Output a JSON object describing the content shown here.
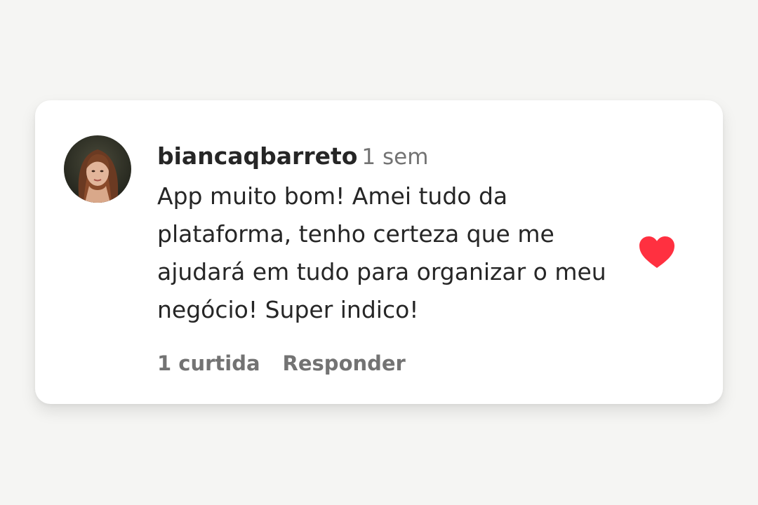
{
  "comment": {
    "username": "biancaqbarreto",
    "timestamp": "1 sem",
    "text": "App muito bom! Amei tudo da plataforma, tenho certeza que me ajudará em tudo para organizar o meu negócio! Super indico!",
    "likes_label": "1 curtida",
    "reply_label": "Responder",
    "liked": true
  },
  "colors": {
    "background": "#f5f5f3",
    "card": "#ffffff",
    "text_primary": "#262626",
    "text_secondary": "#737373",
    "heart": "#ff3040"
  },
  "icons": {
    "like": "heart-icon"
  }
}
